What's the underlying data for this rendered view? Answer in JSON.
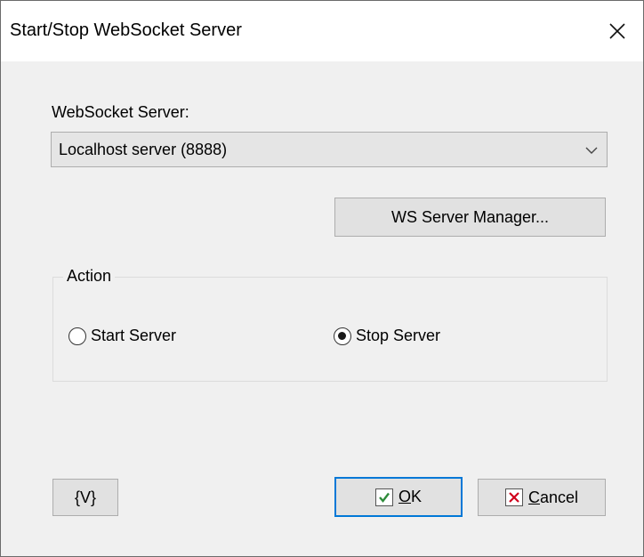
{
  "window": {
    "title": "Start/Stop WebSocket Server"
  },
  "server": {
    "label": "WebSocket Server:",
    "selected": "Localhost server (8888)",
    "manager_button": "WS Server Manager..."
  },
  "action": {
    "group_label": "Action",
    "options": [
      {
        "label": "Start Server",
        "selected": false
      },
      {
        "label": "Stop Server",
        "selected": true
      }
    ]
  },
  "footer": {
    "variables_button": "{V}",
    "ok_mnemonic": "O",
    "ok_rest": "K",
    "cancel_mnemonic": "C",
    "cancel_rest": "ancel"
  },
  "colors": {
    "accent": "#0078d7",
    "ok_check": "#2e8b3a",
    "cancel_x": "#d0021b"
  },
  "icons": [
    "close-icon",
    "chevron-down-icon",
    "check-icon",
    "x-icon"
  ]
}
